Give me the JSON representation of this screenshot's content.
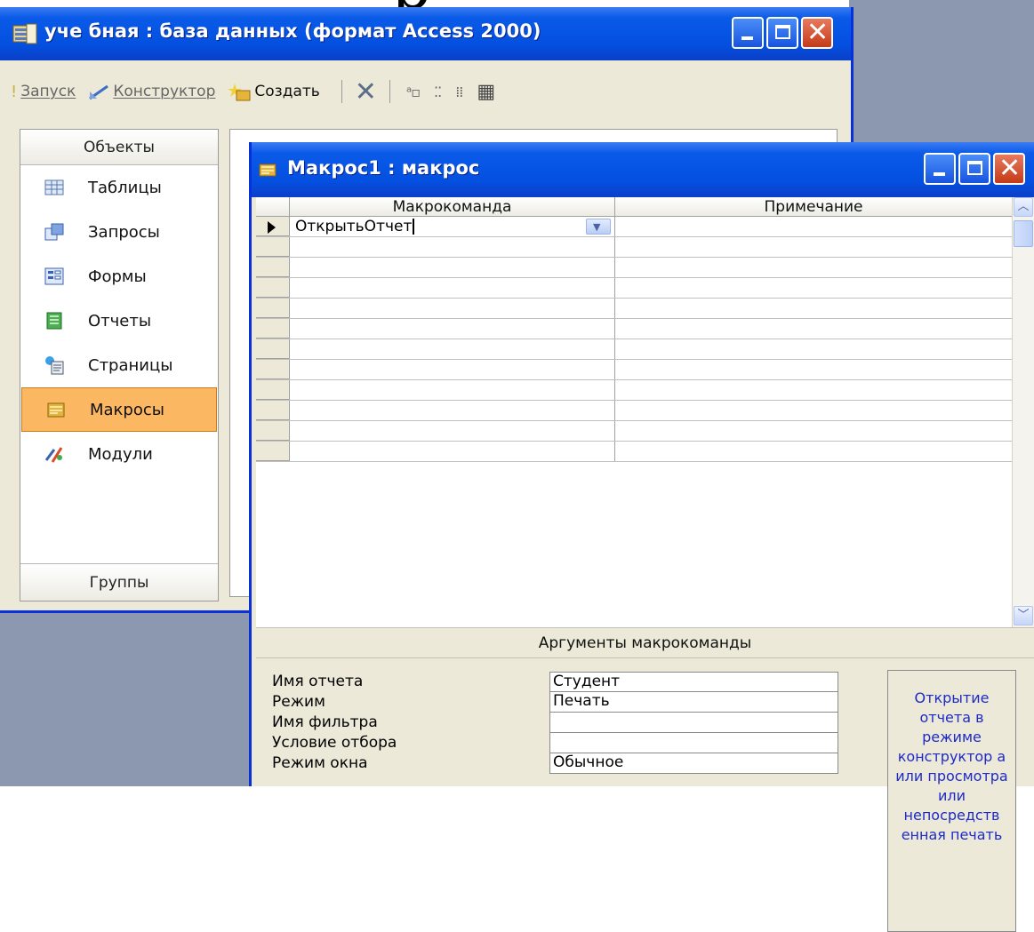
{
  "db_window": {
    "title": "уче бная : база данных (формат Access 2000)",
    "toolbar": {
      "run_label": "Запуск",
      "design_label": "Конструктор",
      "create_label": "Создать",
      "delete_glyph": "✕",
      "large_icons_glyph": "ᵃ▫",
      "small_icons_glyph": "⁚⁚",
      "list_glyph": "⁞⁞",
      "details_glyph": "▦"
    },
    "objects_header": "Объекты",
    "objects": [
      {
        "label": "Таблицы",
        "icon": "table-icon"
      },
      {
        "label": "Запросы",
        "icon": "query-icon"
      },
      {
        "label": "Формы",
        "icon": "form-icon"
      },
      {
        "label": "Отчеты",
        "icon": "report-icon"
      },
      {
        "label": "Страницы",
        "icon": "page-icon"
      },
      {
        "label": "Макросы",
        "icon": "macro-icon",
        "selected": true
      },
      {
        "label": "Модули",
        "icon": "module-icon"
      }
    ],
    "groups_header": "Группы"
  },
  "macro_window": {
    "title": "Макрос1 : макрос",
    "columns": {
      "action": "Макрокоманда",
      "comment": "Примечание"
    },
    "rows": [
      {
        "action": "ОткрытьОтчет",
        "comment": ""
      },
      {
        "action": "",
        "comment": ""
      },
      {
        "action": "",
        "comment": ""
      },
      {
        "action": "",
        "comment": ""
      },
      {
        "action": "",
        "comment": ""
      },
      {
        "action": "",
        "comment": ""
      },
      {
        "action": "",
        "comment": ""
      },
      {
        "action": "",
        "comment": ""
      },
      {
        "action": "",
        "comment": ""
      },
      {
        "action": "",
        "comment": ""
      },
      {
        "action": "",
        "comment": ""
      },
      {
        "action": "",
        "comment": ""
      }
    ],
    "arguments_header": "Аргументы макрокоманды",
    "arguments": [
      {
        "label": "Имя отчета",
        "value": "Студент"
      },
      {
        "label": "Режим",
        "value": "Печать"
      },
      {
        "label": "Имя фильтра",
        "value": ""
      },
      {
        "label": "Условие отбора",
        "value": ""
      },
      {
        "label": "Режим окна",
        "value": "Обычное"
      }
    ],
    "help_text": "Открытие отчета в режиме конструктор а или просмотра или непосредств енная печать"
  },
  "colors": {
    "titlebar": "#0450e0",
    "selected_object": "#fbb762",
    "help_text": "#1e2ac8",
    "window_face": "#ece9d8"
  }
}
